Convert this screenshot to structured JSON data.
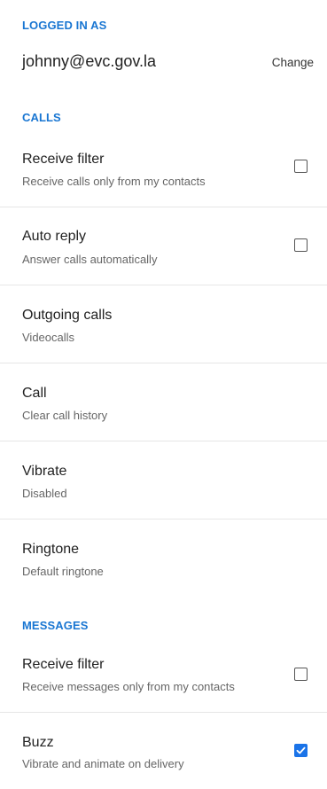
{
  "account": {
    "section_label": "LOGGED IN AS",
    "email": "johnny@evc.gov.la",
    "change_label": "Change"
  },
  "calls": {
    "section_label": "CALLS",
    "items": [
      {
        "title": "Receive filter",
        "subtitle": "Receive calls only from my contacts",
        "checkbox": "unchecked"
      },
      {
        "title": "Auto reply",
        "subtitle": "Answer calls automatically",
        "checkbox": "unchecked"
      },
      {
        "title": "Outgoing calls",
        "subtitle": "Videocalls"
      },
      {
        "title": "Call",
        "subtitle": "Clear call history"
      },
      {
        "title": "Vibrate",
        "subtitle": "Disabled"
      },
      {
        "title": "Ringtone",
        "subtitle": "Default ringtone"
      }
    ]
  },
  "messages": {
    "section_label": "MESSAGES",
    "items": [
      {
        "title": "Receive filter",
        "subtitle": "Receive messages only from my contacts",
        "checkbox": "unchecked"
      },
      {
        "title": "Buzz",
        "subtitle": "Vibrate and animate on delivery",
        "checkbox": "checked"
      }
    ]
  },
  "colors": {
    "accent": "#1976d2",
    "checkbox_checked": "#1a73e8"
  }
}
